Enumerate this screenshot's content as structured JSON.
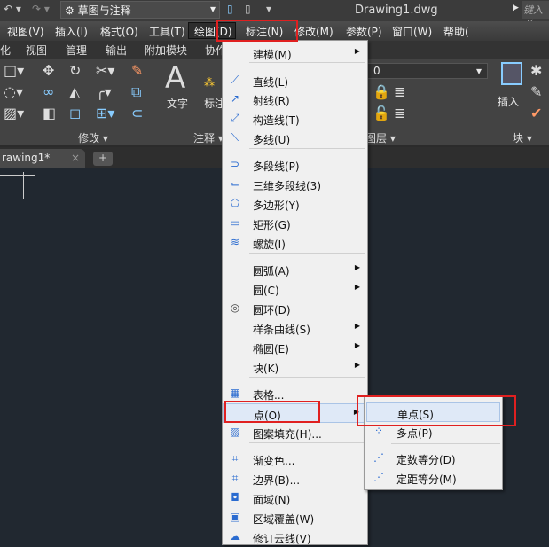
{
  "titlebar": {
    "workspace": "草图与注释",
    "doc_title": "Drawing1.dwg",
    "search_placeholder": "键入关"
  },
  "menubar": [
    {
      "label": "视图(V)"
    },
    {
      "label": "插入(I)"
    },
    {
      "label": "格式(O)"
    },
    {
      "label": "工具(T)"
    },
    {
      "label": "绘图(D)"
    },
    {
      "label": "标注(N)"
    },
    {
      "label": "修改(M)"
    },
    {
      "label": "参数(P)"
    },
    {
      "label": "窗口(W)"
    },
    {
      "label": "帮助("
    }
  ],
  "ribbon_tabs": [
    "化",
    "视图",
    "管理",
    "输出",
    "附加模块",
    "协作"
  ],
  "ribbon": {
    "text_label": "文字",
    "dim_label": "标注",
    "insert_label": "插入",
    "layer_value": "0",
    "panels": [
      "修改 ▾",
      "注释 ▾",
      "图层 ▾",
      "块 ▾"
    ]
  },
  "doc_tab": {
    "label": "rawing1*"
  },
  "draw_menu": {
    "items": [
      {
        "label": "建模(M)",
        "icon": "none",
        "submenu": true
      },
      {
        "label": "直线(L)",
        "icon": "line-icon"
      },
      {
        "label": "射线(R)",
        "icon": "ray-icon"
      },
      {
        "label": "构造线(T)",
        "icon": "xline-icon"
      },
      {
        "label": "多线(U)",
        "icon": "mline-icon"
      },
      {
        "label": "多段线(P)",
        "icon": "polyline-icon"
      },
      {
        "label": "三维多段线(3)",
        "icon": "3dpoly-icon"
      },
      {
        "label": "多边形(Y)",
        "icon": "polygon-icon"
      },
      {
        "label": "矩形(G)",
        "icon": "rectangle-icon"
      },
      {
        "label": "螺旋(I)",
        "icon": "helix-icon"
      },
      {
        "label": "圆弧(A)",
        "icon": "none",
        "submenu": true
      },
      {
        "label": "圆(C)",
        "icon": "none",
        "submenu": true
      },
      {
        "label": "圆环(D)",
        "icon": "donut-icon"
      },
      {
        "label": "样条曲线(S)",
        "icon": "none",
        "submenu": true
      },
      {
        "label": "椭圆(E)",
        "icon": "none",
        "submenu": true
      },
      {
        "label": "块(K)",
        "icon": "none",
        "submenu": true
      },
      {
        "label": "表格...",
        "icon": "table-icon"
      },
      {
        "label": "点(O)",
        "icon": "none",
        "submenu": true
      },
      {
        "label": "图案填充(H)...",
        "icon": "hatch-icon"
      },
      {
        "label": "渐变色...",
        "icon": "gradient-icon"
      },
      {
        "label": "边界(B)...",
        "icon": "boundary-icon"
      },
      {
        "label": "面域(N)",
        "icon": "region-icon"
      },
      {
        "label": "区域覆盖(W)",
        "icon": "wipeout-icon"
      },
      {
        "label": "修订云线(V)",
        "icon": "revcloud-icon"
      }
    ]
  },
  "point_submenu": {
    "items": [
      {
        "label": "单点(S)"
      },
      {
        "label": "多点(P)"
      },
      {
        "label": "定数等分(D)"
      },
      {
        "label": "定距等分(M)"
      }
    ]
  }
}
